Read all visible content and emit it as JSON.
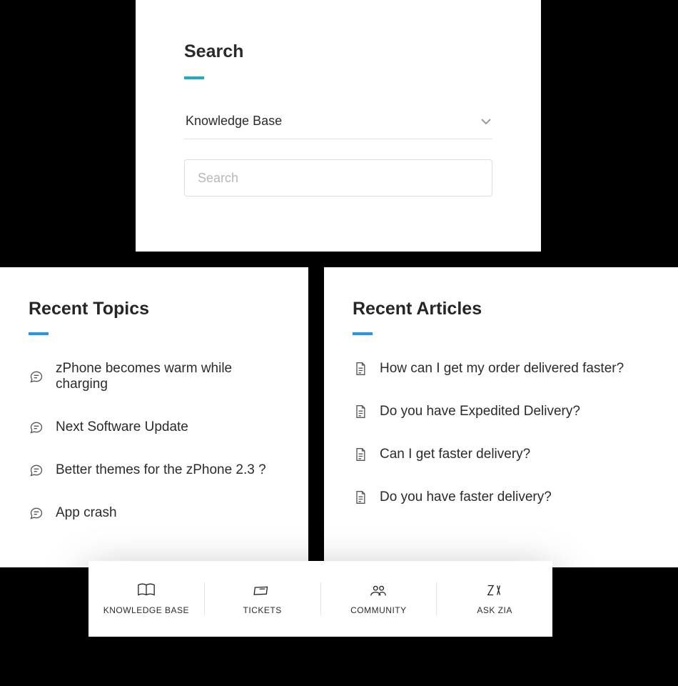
{
  "search": {
    "title": "Search",
    "scope_label": "Knowledge Base",
    "input_placeholder": "Search"
  },
  "recent_topics": {
    "title": "Recent Topics",
    "items": [
      "zPhone becomes warm while charging",
      "Next Software Update",
      "Better themes for the zPhone 2.3 ?",
      "App crash"
    ]
  },
  "recent_articles": {
    "title": "Recent Articles",
    "items": [
      "How can I get my order delivered faster?",
      "Do you have Expedited Delivery?",
      "Can I get faster delivery?",
      "Do you have faster delivery?"
    ]
  },
  "nav": {
    "items": [
      {
        "label": "KNOWLEDGE BASE",
        "icon": "book"
      },
      {
        "label": "TICKETS",
        "icon": "ticket"
      },
      {
        "label": "COMMUNITY",
        "icon": "people"
      },
      {
        "label": "ASK ZIA",
        "icon": "zia"
      }
    ]
  }
}
